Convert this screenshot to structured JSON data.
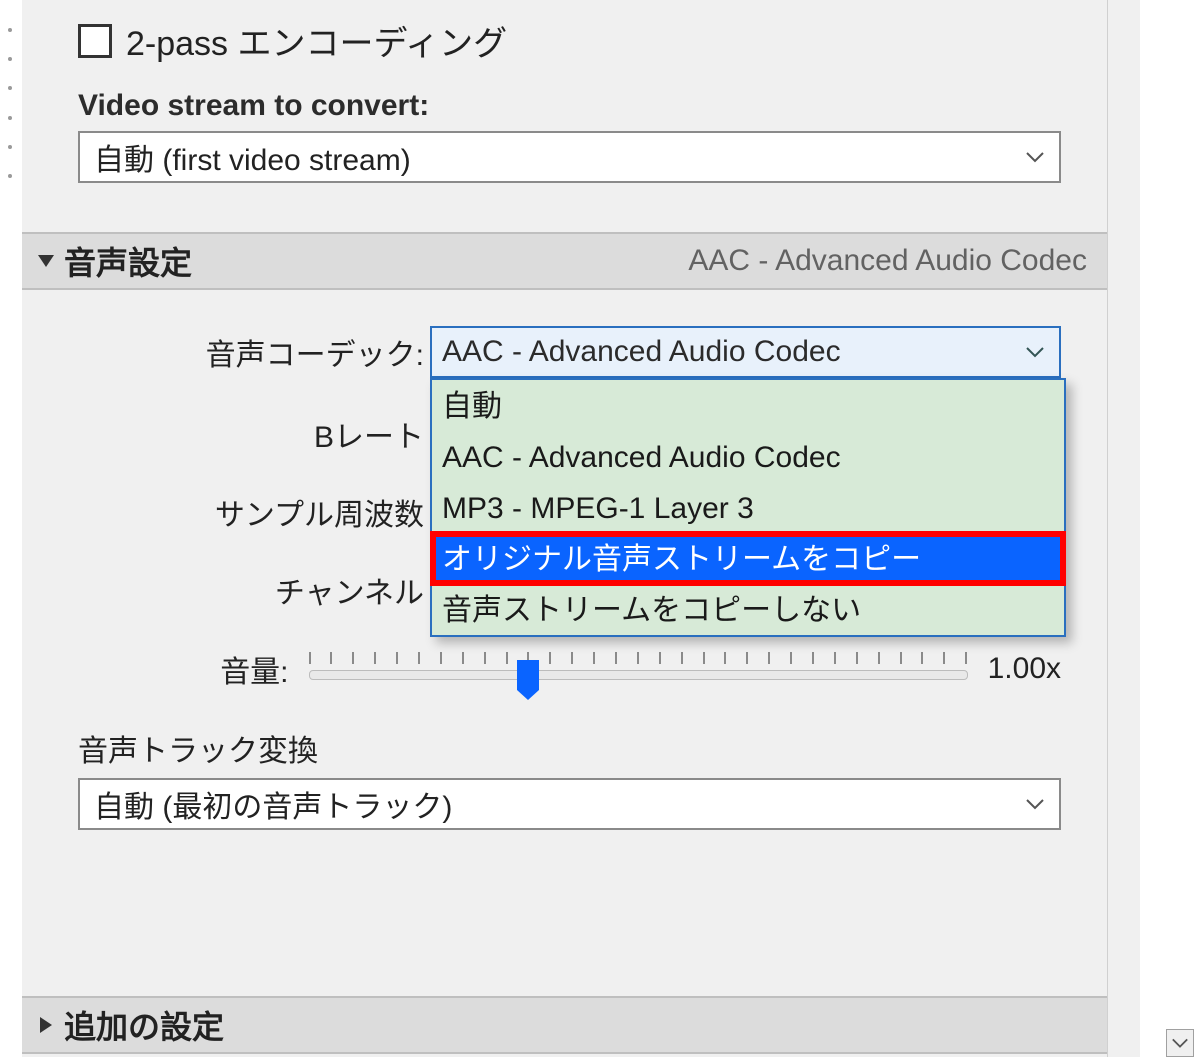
{
  "video": {
    "twopass_label": "2-pass エンコーディング",
    "stream_label": "Video stream to convert:",
    "stream_value": "自動 (first video stream)"
  },
  "audio": {
    "header": "音声設定",
    "header_sub": "AAC - Advanced Audio Codec",
    "codec_label": "音声コーデック:",
    "codec_value": "AAC - Advanced Audio Codec",
    "codec_options": {
      "0": "自動",
      "1": "AAC - Advanced Audio Codec",
      "2": "MP3 - MPEG-1 Layer 3",
      "3": "オリジナル音声ストリームをコピー",
      "4": "音声ストリームをコピーしない"
    },
    "bitrate_label": "Bレート",
    "samplerate_label": "サンプル周波数",
    "channel_label": "チャンネル",
    "volume_label": "音量:",
    "volume_value": "1.00x",
    "track_label": "音声トラック変換",
    "track_value": "自動 (最初の音声トラック)"
  },
  "extra": {
    "header": "追加の設定"
  }
}
